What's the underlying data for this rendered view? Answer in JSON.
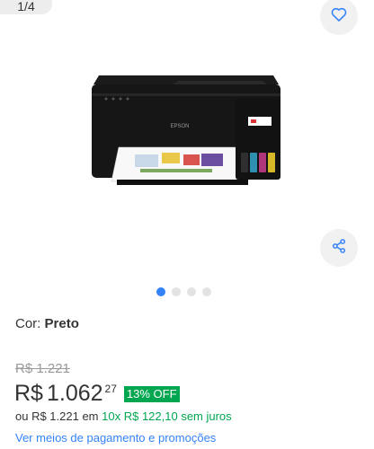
{
  "gallery": {
    "counter": "1/4",
    "total_images": 4,
    "active_index": 0,
    "product_image_icon": "epson-printer-image",
    "brand_text": "EPSON"
  },
  "product": {
    "color_label": "Cor:",
    "color_value": "Preto"
  },
  "pricing": {
    "old_price": "R$ 1.221",
    "currency": "R$",
    "price_integer": "1.062",
    "price_cents": "27",
    "discount": "13% OFF",
    "installments_prefix": "ou R$ 1.221 em",
    "installments_detail": "10x R$ 122,10 sem juros",
    "payment_link": "Ver meios de pagamento e promoções"
  },
  "icons": {
    "favorite": "heart-icon",
    "share": "share-icon"
  },
  "colors": {
    "accent_blue": "#3483fa",
    "discount_green": "#00a650"
  }
}
